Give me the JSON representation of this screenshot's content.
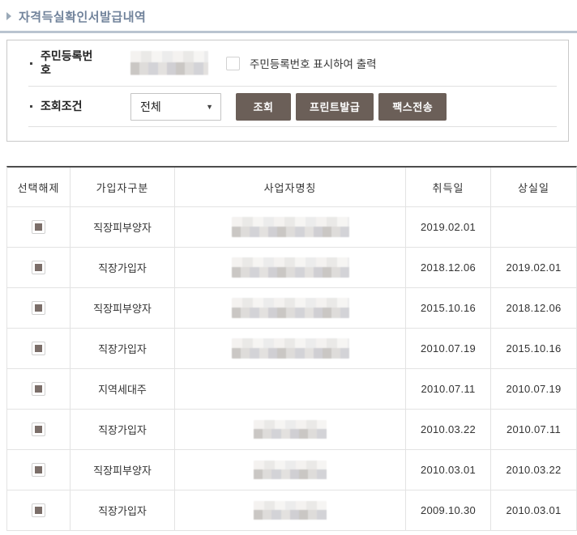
{
  "page": {
    "title": "자격득실확인서발급내역"
  },
  "form": {
    "rrn_label": "주민등록번호",
    "rrn_value_masked": "masked",
    "rrn_checkbox_label": "주민등록번호 표시하여 출력",
    "condition_label": "조회조건",
    "condition_select_value": "전체",
    "buttons": [
      {
        "label": "조회"
      },
      {
        "label": "프린트발급"
      },
      {
        "label": "팩스전송"
      }
    ]
  },
  "table": {
    "headers": [
      "선택해제",
      "가입자구분",
      "사업자명칭",
      "취득일",
      "상실일"
    ],
    "rows": [
      {
        "type": "직장피부양자",
        "business_name_masked": "wide",
        "acquired": "2019.02.01",
        "lost": ""
      },
      {
        "type": "직장가입자",
        "business_name_masked": "wide",
        "acquired": "2018.12.06",
        "lost": "2019.02.01"
      },
      {
        "type": "직장피부양자",
        "business_name_masked": "wide",
        "acquired": "2015.10.16",
        "lost": "2018.12.06"
      },
      {
        "type": "직장가입자",
        "business_name_masked": "wide",
        "acquired": "2010.07.19",
        "lost": "2015.10.16"
      },
      {
        "type": "지역세대주",
        "business_name_masked": "none",
        "acquired": "2010.07.11",
        "lost": "2010.07.19"
      },
      {
        "type": "직장가입자",
        "business_name_masked": "small",
        "acquired": "2010.03.22",
        "lost": "2010.07.11"
      },
      {
        "type": "직장피부양자",
        "business_name_masked": "small",
        "acquired": "2010.03.01",
        "lost": "2010.03.22"
      },
      {
        "type": "직장가입자",
        "business_name_masked": "small",
        "acquired": "2009.10.30",
        "lost": "2010.03.01"
      }
    ]
  },
  "colors": {
    "title": "#71839b",
    "title_rule": "#b9c4d0",
    "button_bg": "#6b5f58",
    "table_top_border": "#4c4c4c",
    "cell_border": "#e3e3e3",
    "checkbox_fill": "#7b6e69"
  }
}
